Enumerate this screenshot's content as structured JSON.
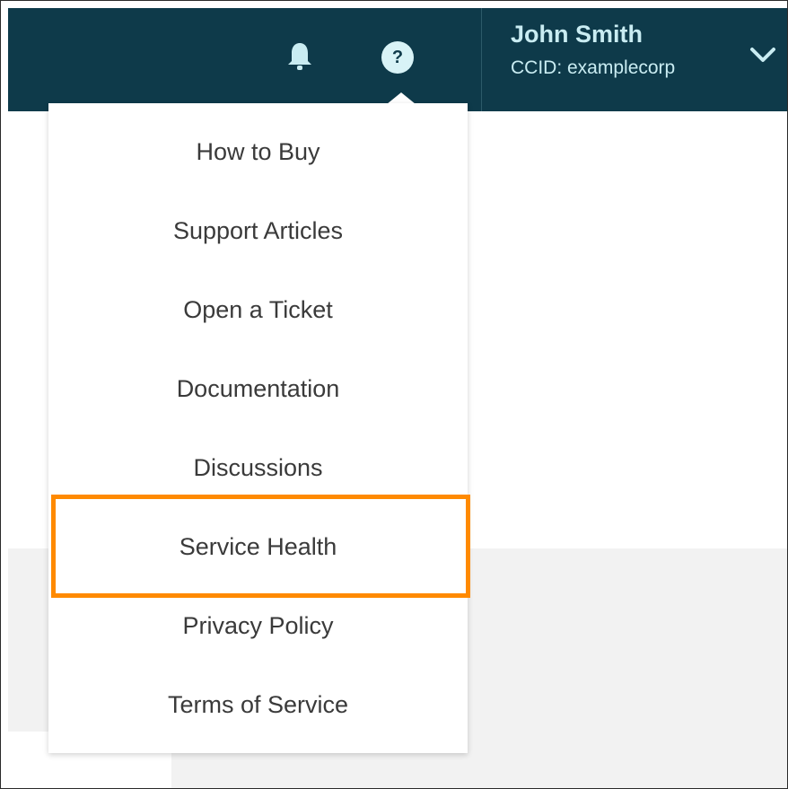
{
  "header": {
    "user_name": "John Smith",
    "ccid": "CCID: examplecorp",
    "icons": {
      "notifications": "bell-icon",
      "help": "help-icon",
      "account_menu": "chevron-down-icon"
    },
    "help_glyph": "?"
  },
  "help_menu": {
    "items": [
      {
        "label": "How to Buy"
      },
      {
        "label": "Support Articles"
      },
      {
        "label": "Open a Ticket"
      },
      {
        "label": "Documentation"
      },
      {
        "label": "Discussions"
      },
      {
        "label": "Service Health"
      },
      {
        "label": "Privacy Policy"
      },
      {
        "label": "Terms of Service"
      }
    ],
    "highlighted_item": "Service Health"
  },
  "colors": {
    "topbar": "#0e3a4a",
    "highlight": "#ff8a00"
  }
}
